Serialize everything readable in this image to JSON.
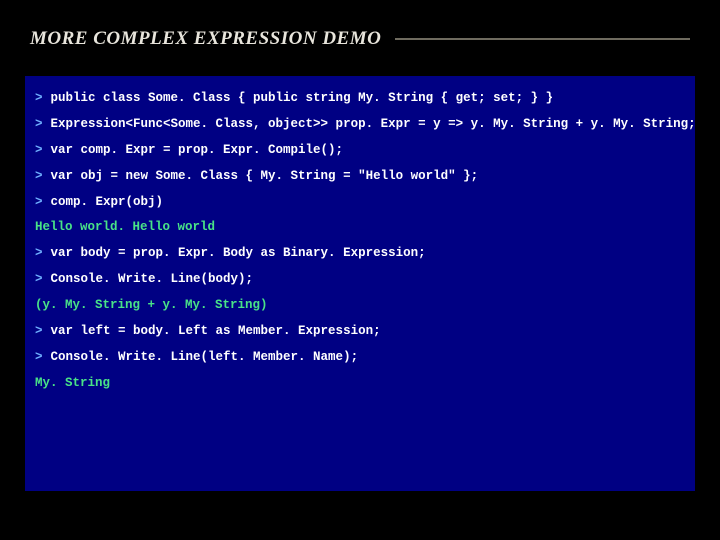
{
  "title": "MORE COMPLEX EXPRESSION DEMO",
  "prompt": ">",
  "lines": [
    {
      "type": "input",
      "text": "public class Some. Class { public string My. String { get; set; } }"
    },
    {
      "type": "input",
      "text": "Expression<Func<Some. Class, object>> prop. Expr = y => y. My. String + y. My. String;"
    },
    {
      "type": "input",
      "text": "var comp. Expr = prop. Expr. Compile();"
    },
    {
      "type": "input",
      "text": "var obj = new Some. Class { My. String = \"Hello world\" };"
    },
    {
      "type": "input",
      "text": "comp. Expr(obj)"
    },
    {
      "type": "output",
      "text": "Hello world. Hello world"
    },
    {
      "type": "input",
      "text": "var body = prop. Expr. Body as Binary. Expression;"
    },
    {
      "type": "input",
      "text": "Console. Write. Line(body);"
    },
    {
      "type": "output",
      "text": "(y. My. String + y. My. String)"
    },
    {
      "type": "input",
      "text": "var left = body. Left as Member. Expression;"
    },
    {
      "type": "input",
      "text": "Console. Write. Line(left. Member. Name);"
    },
    {
      "type": "output",
      "text": "My. String"
    }
  ]
}
